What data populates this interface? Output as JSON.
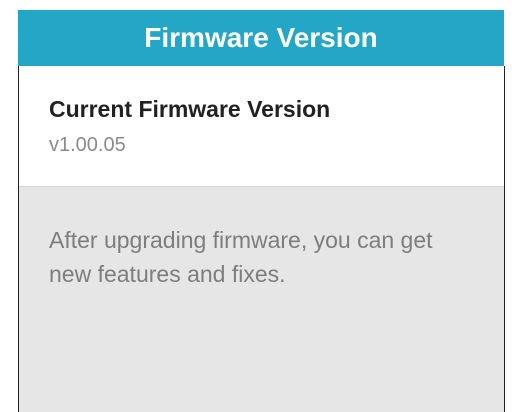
{
  "header": {
    "title": "Firmware Version"
  },
  "info": {
    "label": "Current Firmware Version",
    "value": "v1.00.05"
  },
  "description": {
    "text": "After upgrading firmware, you can get new features and fixes."
  },
  "colors": {
    "header_bg": "#24a7c7",
    "header_text": "#ffffff",
    "section_bg": "#e6e6e6"
  }
}
